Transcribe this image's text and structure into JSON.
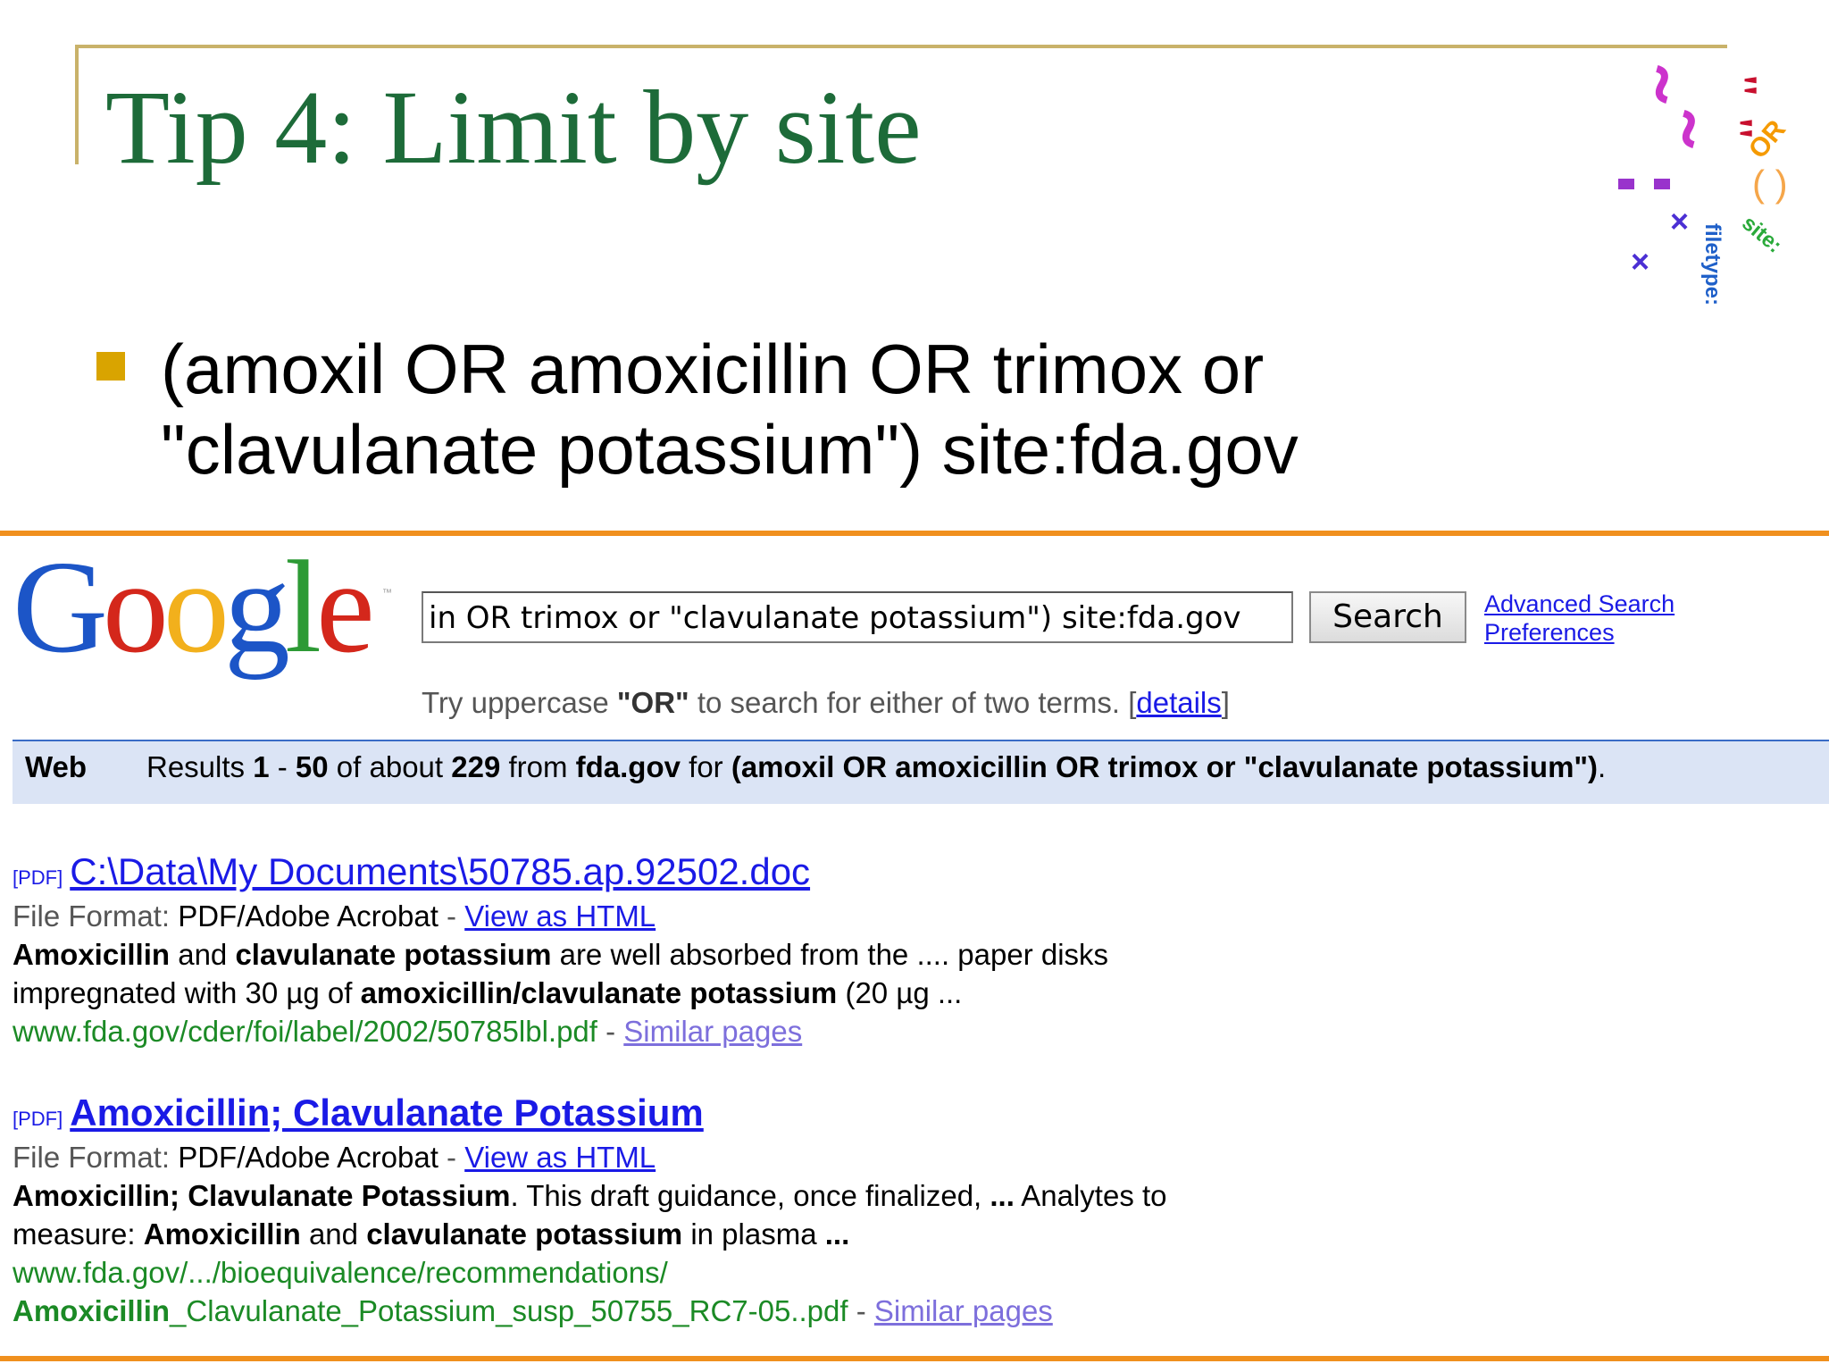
{
  "slide": {
    "title": "Tip 4: Limit by site",
    "bullet_line1": "(amoxil OR amoxicillin OR trimox or",
    "bullet_line2": "\"clavulanate potassium\") site:fda.gov"
  },
  "logo_art": {
    "labels": [
      "OR",
      "site:",
      "filetype:",
      "( )"
    ],
    "colors": {
      "quote": "#c8102e",
      "tilde": "#cc33cc",
      "or": "#f59a00",
      "site": "#2aaa3a",
      "filetype": "#1f60c9",
      "minus": "#9933cc",
      "x": "#4b2fd4"
    }
  },
  "google": {
    "logo_letters": [
      "G",
      "o",
      "o",
      "g",
      "l",
      "e"
    ],
    "tm": "™",
    "query": "in OR trimox or \"clavulanate potassium\") site:fda.gov",
    "search_button": "Search",
    "advanced_search": "Advanced Search",
    "preferences": "Preferences",
    "tip_prefix": "Try uppercase ",
    "tip_or": "\"OR\"",
    "tip_suffix": " to search for either of two terms. [",
    "tip_details": "details",
    "tip_close": "]"
  },
  "result_bar": {
    "web": "Web",
    "text_prefix": "Results ",
    "range_start": "1",
    "dash": " - ",
    "range_end": "50",
    "of_about": " of about ",
    "count": "229",
    "from": " from ",
    "site": "fda.gov",
    "for": " for ",
    "query": "(amoxil OR amoxicillin OR trimox or \"clavulanate potassium\")",
    "end": "."
  },
  "results": [
    {
      "tag": "[PDF]",
      "title": "C:\\Data\\My Documents\\50785.ap.92502.doc",
      "format_label": "File Format: ",
      "format_value": "PDF/Adobe Acrobat",
      "sep": " - ",
      "view_html": "View as HTML",
      "snippet_1a": "Amoxicillin",
      "snippet_1b": " and ",
      "snippet_1c": "clavulanate potassium",
      "snippet_1d": " are well absorbed from the .... paper disks",
      "snippet_2a": "impregnated with 30 µg of ",
      "snippet_2b": "amoxicillin/clavulanate potassium",
      "snippet_2c": " (20 µg ...",
      "url": "www.fda.gov/cder/foi/label/2002/50785lbl.pdf",
      "similar": "Similar pages"
    },
    {
      "tag": "[PDF]",
      "title": "Amoxicillin; Clavulanate Potassium",
      "format_label": "File Format: ",
      "format_value": "PDF/Adobe Acrobat",
      "sep": " - ",
      "view_html": "View as HTML",
      "snippet_1a": "Amoxicillin; Clavulanate Potassium",
      "snippet_1b": ". This draft guidance, once finalized, ",
      "snippet_1c": "...",
      "snippet_1d": " Analytes to",
      "snippet_2a": "measure: ",
      "snippet_2b": "Amoxicillin",
      "snippet_2c": " and ",
      "snippet_2d": "clavulanate potassium",
      "snippet_2e": " in plasma ",
      "snippet_2f": "...",
      "url_line1": "www.fda.gov/.../bioequivalence/recommendations/",
      "url_line2a": "Amoxicillin",
      "url_line2b": "_Clavulanate_Potassium_susp_50755_RC7-05..pdf",
      "similar": "Similar pages"
    }
  ]
}
